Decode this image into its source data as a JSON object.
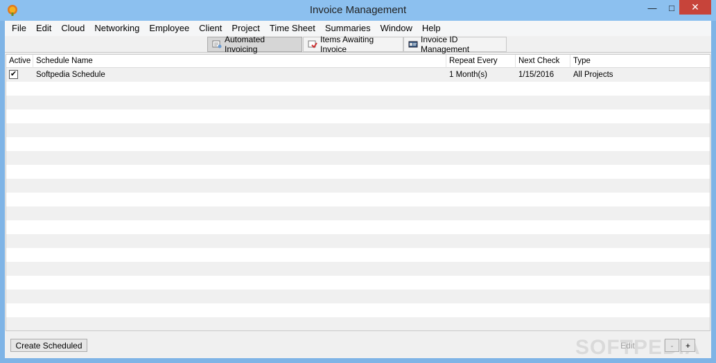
{
  "window": {
    "title": "Invoice Management",
    "minimize": "—",
    "maximize": "□",
    "close": "✕"
  },
  "menu": [
    "File",
    "Edit",
    "Cloud",
    "Networking",
    "Employee",
    "Client",
    "Project",
    "Time Sheet",
    "Summaries",
    "Window",
    "Help"
  ],
  "tabs": [
    {
      "label": "Automated Invoicing",
      "icon": "automation-icon",
      "active": true
    },
    {
      "label": "Items Awaiting Invoice",
      "icon": "invoice-items-icon",
      "active": false
    },
    {
      "label": "Invoice ID Management",
      "icon": "id-card-icon",
      "active": false
    }
  ],
  "table": {
    "headers": {
      "active": "Active",
      "name": "Schedule Name",
      "repeat": "Repeat Every",
      "next": "Next Check",
      "type": "Type"
    },
    "rows": [
      {
        "active": true,
        "name": "Softpedia Schedule",
        "repeat": "1 Month(s)",
        "next": "1/15/2016",
        "type": "All Projects"
      }
    ]
  },
  "buttons": {
    "create": "Create Scheduled",
    "edit": "Edit",
    "remove": "-",
    "add": "+"
  },
  "watermark": "SOFTPEDIA",
  "colors": {
    "titlebar": "#8cc0ef",
    "close": "#c7443a",
    "row_alt": "#f0f0f0"
  }
}
